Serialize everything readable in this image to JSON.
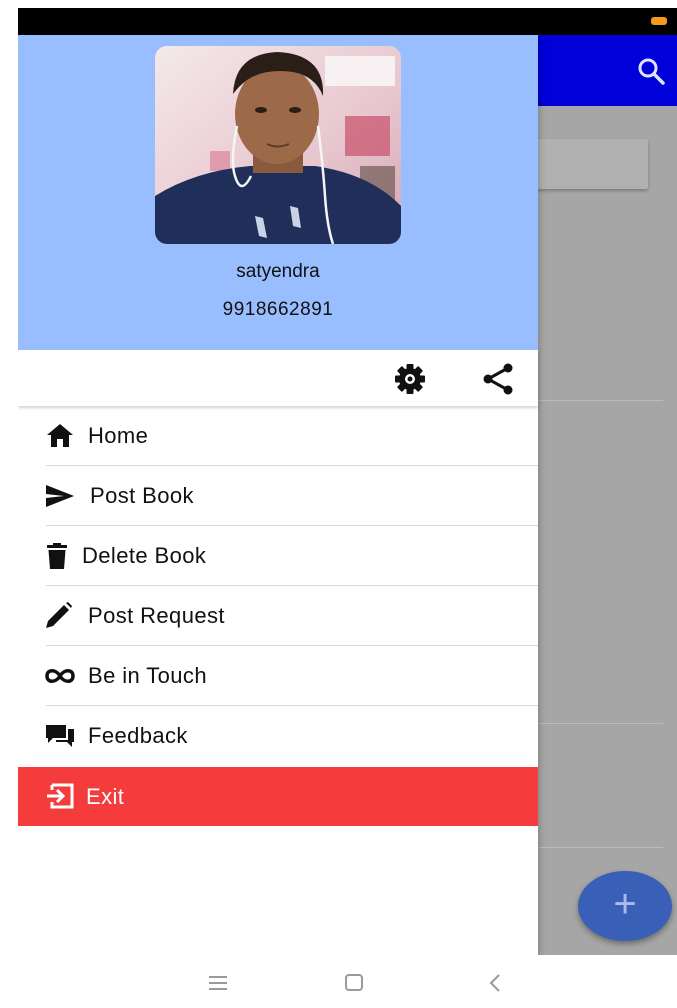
{
  "user": {
    "name": "satyendra",
    "phone": "9918662891",
    "avatar_icon": "profile-photo"
  },
  "header_actions": {
    "settings_icon": "gear-icon",
    "share_icon": "share-icon"
  },
  "menu": {
    "items": [
      {
        "label": "Home",
        "icon": "home-icon"
      },
      {
        "label": "Post Book",
        "icon": "send-icon"
      },
      {
        "label": "Delete Book",
        "icon": "trash-icon"
      },
      {
        "label": "Post Request",
        "icon": "pencil-icon"
      },
      {
        "label": "Be in Touch",
        "icon": "infinity-icon"
      },
      {
        "label": "Feedback",
        "icon": "chat-icon"
      }
    ],
    "exit": {
      "label": "Exit",
      "icon": "exit-icon"
    }
  },
  "background_app": {
    "search_icon": "search-icon",
    "fab_label": "+"
  },
  "colors": {
    "drawer_header": "#99beff",
    "exit_background": "#f43c3c",
    "app_bar": "#0000d8",
    "fab": "#3a5fb7"
  }
}
